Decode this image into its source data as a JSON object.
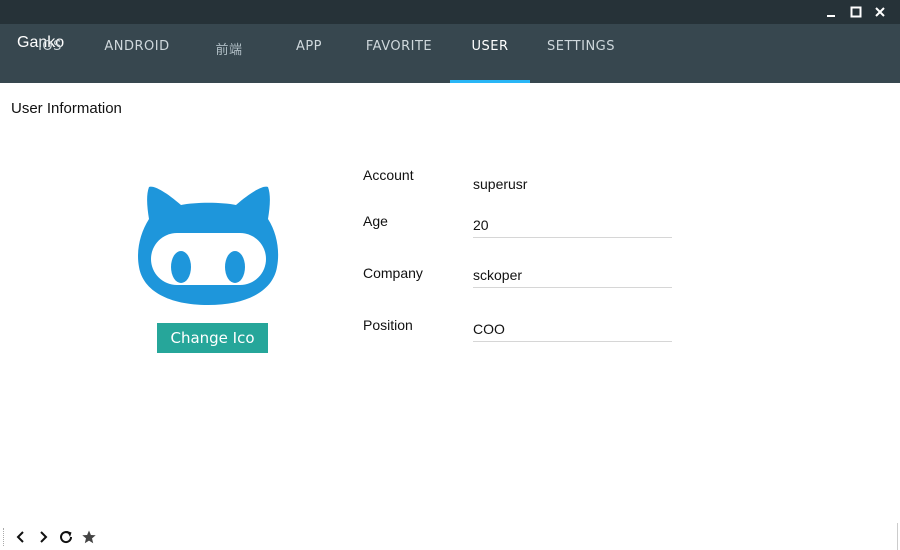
{
  "window": {
    "app_title": "Ganko"
  },
  "tabs": [
    {
      "label": "IOS",
      "active": false
    },
    {
      "label": "ANDROID",
      "active": false
    },
    {
      "label": "前端",
      "active": false
    },
    {
      "label": "APP",
      "active": false
    },
    {
      "label": "FAVORITE",
      "active": false
    },
    {
      "label": "USER",
      "active": true
    },
    {
      "label": "SETTINGS",
      "active": false
    }
  ],
  "user": {
    "section_title": "User Information",
    "change_icon_label": "Change Ico",
    "fields": {
      "account": {
        "label": "Account",
        "value": "superusr"
      },
      "age": {
        "label": "Age",
        "value": "20"
      },
      "company": {
        "label": "Company",
        "value": "sckoper"
      },
      "position": {
        "label": "Position",
        "value": "COO"
      }
    }
  },
  "icons": {
    "minimize": "minimize-icon",
    "maximize": "maximize-icon",
    "close": "close-icon",
    "avatar": "github-octocat-icon",
    "back": "chevron-left-icon",
    "forward": "chevron-right-icon",
    "refresh": "refresh-icon",
    "favorite": "star-icon"
  },
  "colors": {
    "titlebar": "#263238",
    "appbar": "#37474f",
    "tab_indicator": "#29b6f6",
    "button": "#26a69a",
    "avatar": "#1e96db"
  }
}
